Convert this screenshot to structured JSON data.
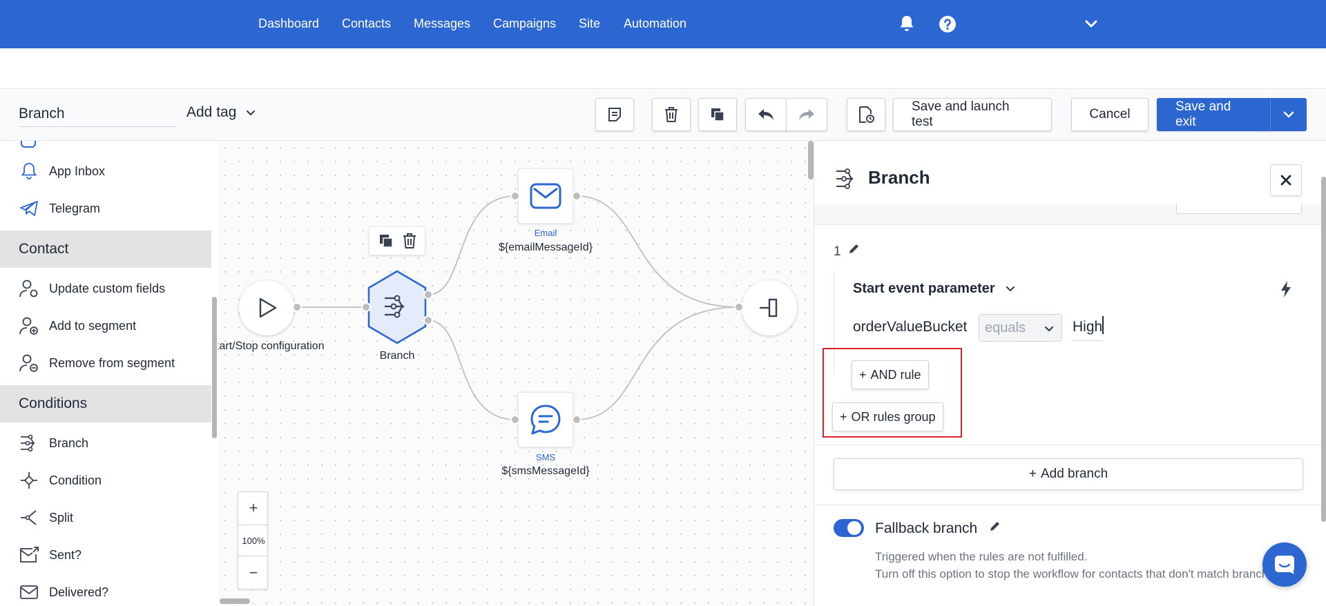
{
  "nav": {
    "items": [
      "Dashboard",
      "Contacts",
      "Messages",
      "Campaigns",
      "Site",
      "Automation"
    ]
  },
  "toolbar": {
    "workflow_name": "Branch",
    "add_tag": "Add tag",
    "save_launch_test": "Save and launch test",
    "cancel": "Cancel",
    "save_exit": "Save and exit"
  },
  "sidebar": {
    "top_items": [
      "App Inbox",
      "Telegram"
    ],
    "contact_header": "Contact",
    "contact_items": [
      "Update custom fields",
      "Add to segment",
      "Remove from segment"
    ],
    "conditions_header": "Conditions",
    "condition_items": [
      "Branch",
      "Condition",
      "Split",
      "Sent?",
      "Delivered?"
    ]
  },
  "canvas": {
    "start_label": "Start/Stop configuration",
    "branch_label": "Branch",
    "email_type": "Email",
    "email_label": "${emailMessageId}",
    "sms_type": "SMS",
    "sms_label": "${smsMessageId}",
    "zoom": "100%"
  },
  "panel": {
    "title": "Branch",
    "branch_number": "1",
    "parameter_title": "Start event parameter",
    "parameter_name": "orderValueBucket",
    "operator": "equals",
    "value": "High",
    "and_rule": "AND rule",
    "or_rules_group": "OR rules group",
    "add_branch": "Add branch",
    "fallback_title": "Fallback branch",
    "fallback_desc_1": "Triggered when the rules are not fulfilled.",
    "fallback_desc_2": "Turn off this option to stop the workflow for contacts that don't match branch rules",
    "fallback_enabled": true
  },
  "colors": {
    "brand": "#2b66d1",
    "highlight": "#e0202a"
  }
}
